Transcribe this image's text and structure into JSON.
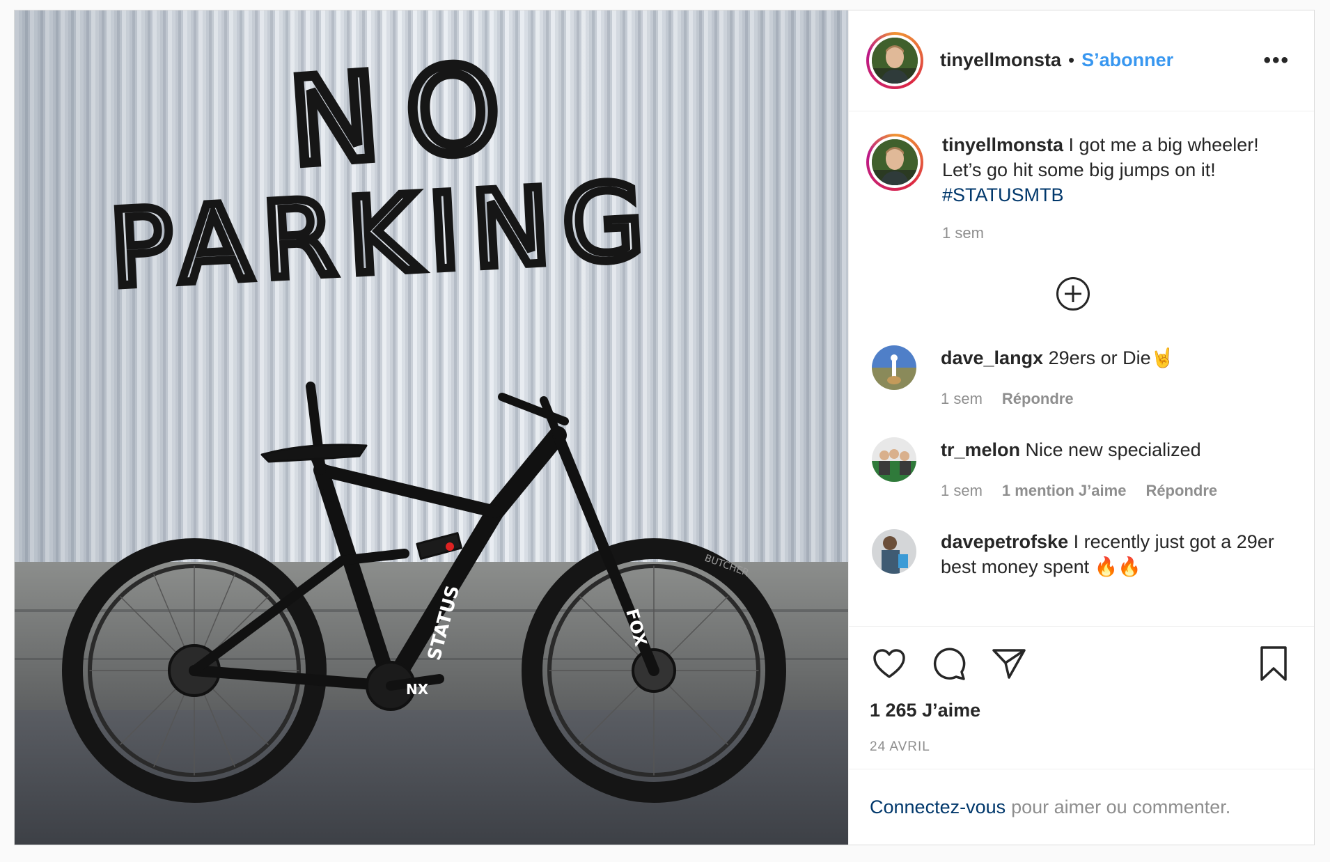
{
  "post": {
    "author": "tinyellmonsta",
    "separator": "•",
    "follow_label": "S’abonner",
    "more_label": "•••",
    "caption": {
      "username": "tinyellmonsta",
      "text": " I got me a big wheeler! Let’s go hit some big jumps on it! ",
      "hashtag": "#STATUSMTB",
      "time": "1 sem"
    },
    "photo": {
      "graffiti_line1": "NO",
      "graffiti_line2": "PARKING",
      "frame_brand": "STATUS",
      "crank_brand": "NX",
      "fork_brand": "FOX",
      "tire_brand": "BUTCHER"
    },
    "comments": [
      {
        "username": "dave_langx",
        "text": " 29ers or Die🤘",
        "time": "1 sem",
        "likes": "",
        "reply": "Répondre"
      },
      {
        "username": "tr_melon",
        "text": " Nice new specialized",
        "time": "1 sem",
        "likes": "1 mention J’aime",
        "reply": "Répondre"
      },
      {
        "username": "davepetrofske",
        "text": " I recently just got a 29er best money spent 🔥🔥",
        "time": "",
        "likes": "",
        "reply": ""
      }
    ],
    "likes_count": "1 265 J’aime",
    "date": "24 AVRIL",
    "login_link": "Connectez-vous",
    "login_text": "pour aimer ou commenter."
  },
  "icons": {
    "like": "heart-icon",
    "comment": "comment-icon",
    "share": "share-icon",
    "save": "bookmark-icon",
    "more": "more-options-icon",
    "load_more": "plus-circle-icon"
  },
  "colors": {
    "follow_blue": "#3897f0",
    "link_blue": "#00376b",
    "muted": "#8e8e8e",
    "text": "#262626",
    "border": "#dbdbdb"
  }
}
